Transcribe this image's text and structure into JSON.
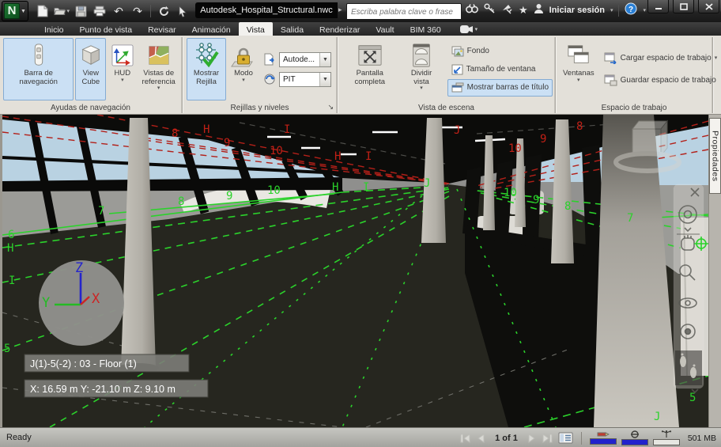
{
  "window": {
    "title": "Autodesk_Hospital_Structural.nwc",
    "controls": {
      "minimize": "minimize",
      "maximize": "maximize",
      "close": "close"
    }
  },
  "infocenter": {
    "search_placeholder": "Escriba palabra clave o frase",
    "signin": "Iniciar sesión"
  },
  "tabs": {
    "items": [
      "Inicio",
      "Punto de vista",
      "Revisar",
      "Animación",
      "Vista",
      "Salida",
      "Renderizar",
      "Vault",
      "BIM 360"
    ],
    "active": "Vista"
  },
  "ribbon": {
    "group1": {
      "label": "Ayudas de navegación",
      "btn_navbar": "Barra de navegación",
      "btn_viewcube": "View Cube",
      "btn_hud": "HUD",
      "btn_refviews": "Vistas de referencia"
    },
    "group2": {
      "label": "Rejillas y niveles",
      "btn_showgrid": "Mostrar Rejilla",
      "btn_mode": "Modo",
      "combo1": "Autode...",
      "combo2": "PIT"
    },
    "group3": {
      "label": "Vista de escena",
      "btn_fullscreen": "Pantalla completa",
      "btn_split": "Dividir vista",
      "btn_background": "Fondo",
      "btn_windowsize": "Tamaño de ventana",
      "btn_titlebars": "Mostrar barras de título"
    },
    "group4": {
      "label": "Espacio de trabajo",
      "btn_windows": "Ventanas",
      "btn_load": "Cargar espacio de trabajo",
      "btn_save": "Guardar espacio de trabajo"
    }
  },
  "viewport": {
    "properties_tab": "Propiedades",
    "hud_item": "J(1)-5(-2) : 03 - Floor (1)",
    "hud_coords": "X: 16.59 m  Y: -21.10 m  Z: 9.10 m",
    "axis": {
      "x": "X",
      "y": "Y",
      "z": "Z"
    },
    "red_labels": [
      "8",
      "H",
      "9",
      "10",
      "I",
      "H",
      "I",
      "J",
      "10",
      "9",
      "8"
    ],
    "green_labels": [
      "6",
      "H",
      "7",
      "I",
      "5",
      "8",
      "9",
      "10",
      "H",
      "I",
      "J",
      "10",
      "9",
      "8",
      "7",
      "5",
      "J"
    ]
  },
  "statusbar": {
    "ready": "Ready",
    "page": "1 of 1",
    "memory": "501 MB"
  },
  "icons": {
    "caret_down": "▾",
    "launcher": "↘",
    "star": "★",
    "title_arrow": "▸",
    "undo": "↶",
    "redo": "↷"
  },
  "colors": {
    "highlight": "#cbe0f4",
    "grid_green": "#2bd22b",
    "grid_red": "#c22016",
    "sky": "#b9d2e2"
  }
}
